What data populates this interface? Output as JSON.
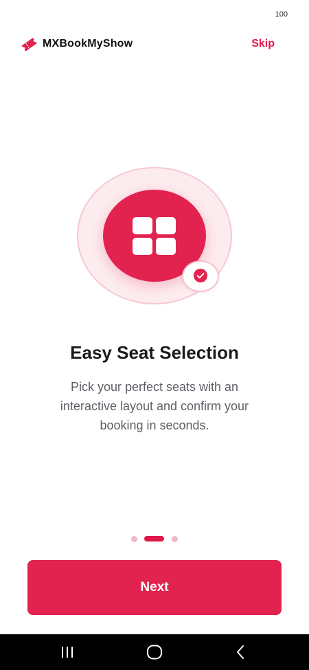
{
  "status_bar": {
    "battery_text": "100"
  },
  "header": {
    "brand_name": "MXBookMyShow",
    "brand_icon": "ticket-icon",
    "skip_label": "Skip"
  },
  "onboarding": {
    "illustration_icon": "seat-grid-icon",
    "badge_icon": "check-icon",
    "title": "Easy Seat Selection",
    "description": "Pick your perfect seats with an interactive layout and confirm your booking in seconds.",
    "pager": {
      "total_pages": 3,
      "current_page": 2
    },
    "next_label": "Next"
  },
  "nav_bar": {
    "buttons": [
      "recents-icon",
      "home-icon",
      "back-icon"
    ]
  },
  "colors": {
    "accent": "#e2224f",
    "accent_text": "#e0184a",
    "ring_fill": "#fdecef",
    "dot_inactive": "#f0b9c6",
    "title_text": "#1a1a1a",
    "body_text": "#5e5e66"
  }
}
